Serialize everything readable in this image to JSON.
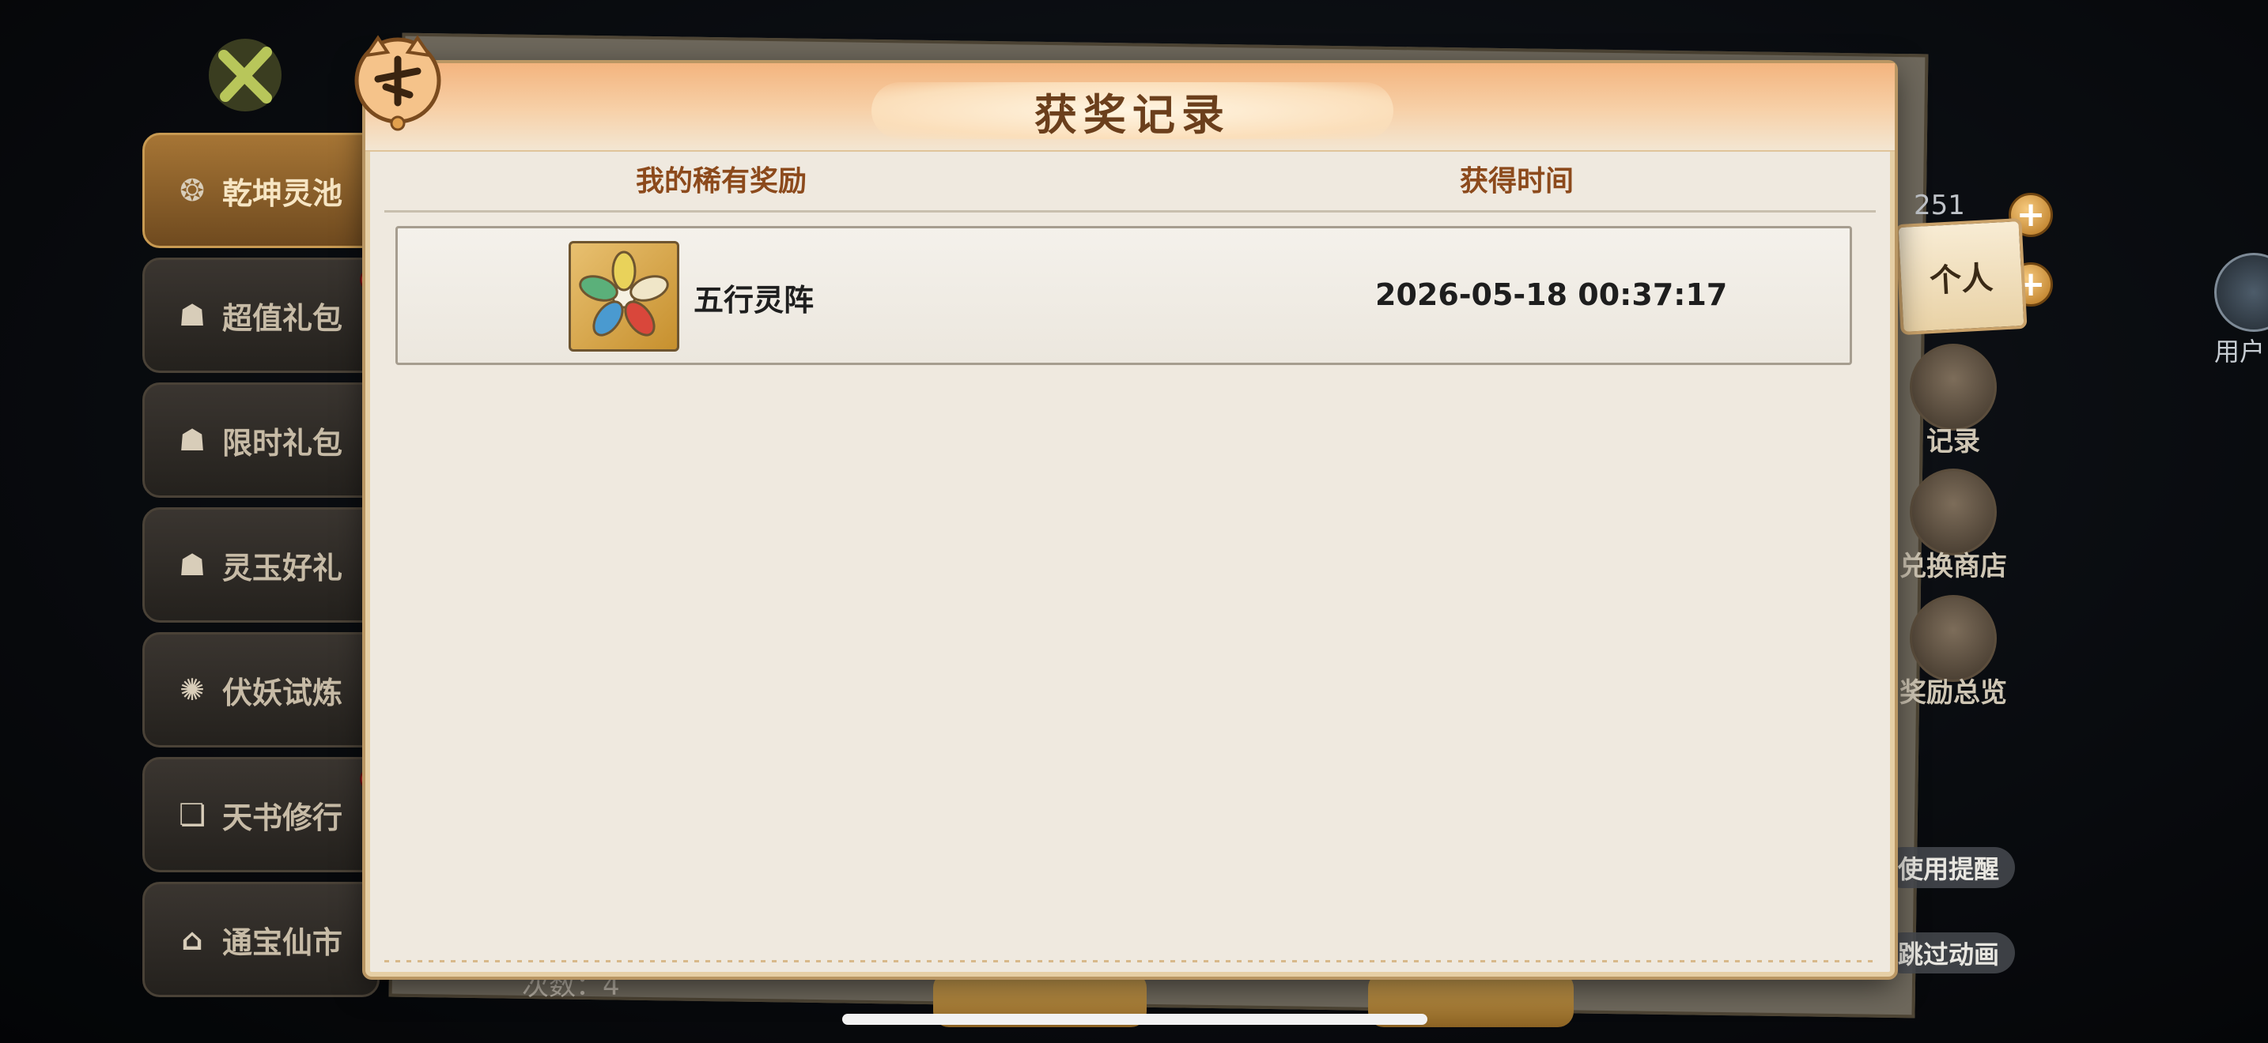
{
  "background": {
    "counter_text": "251",
    "tab_personal": "个人",
    "side_buttons": [
      "记录",
      "兑换商店",
      "奖励总览"
    ],
    "pills": [
      "使用提醒",
      "跳过动画"
    ],
    "user_center_label": "用户",
    "bottom_count": "次数：4"
  },
  "left_menu": {
    "items": [
      {
        "label": "乾坤灵池",
        "icon": "swirl-icon",
        "active": true,
        "dot": false
      },
      {
        "label": "超值礼包",
        "icon": "gift-bag-icon",
        "active": false,
        "dot": true
      },
      {
        "label": "限时礼包",
        "icon": "gift-bag-icon",
        "active": false,
        "dot": false
      },
      {
        "label": "灵玉好礼",
        "icon": "gift-bag-icon",
        "active": false,
        "dot": false
      },
      {
        "label": "伏妖试炼",
        "icon": "demon-icon",
        "active": false,
        "dot": false
      },
      {
        "label": "天书修行",
        "icon": "book-icon",
        "active": false,
        "dot": true
      },
      {
        "label": "通宝仙市",
        "icon": "pavilion-icon",
        "active": false,
        "dot": false
      }
    ]
  },
  "dialog": {
    "title": "获奖记录",
    "columns": {
      "reward": "我的稀有奖励",
      "time": "获得时间"
    },
    "records": [
      {
        "name": "五行灵阵",
        "time": "2026-05-18 00:37:17",
        "icon": "five-elements-icon"
      }
    ]
  },
  "colors": {
    "header_text": "#8c4a1c",
    "title_text": "#6b3f1c",
    "active_menu": "#a67535",
    "red_dot": "#c7282a"
  }
}
